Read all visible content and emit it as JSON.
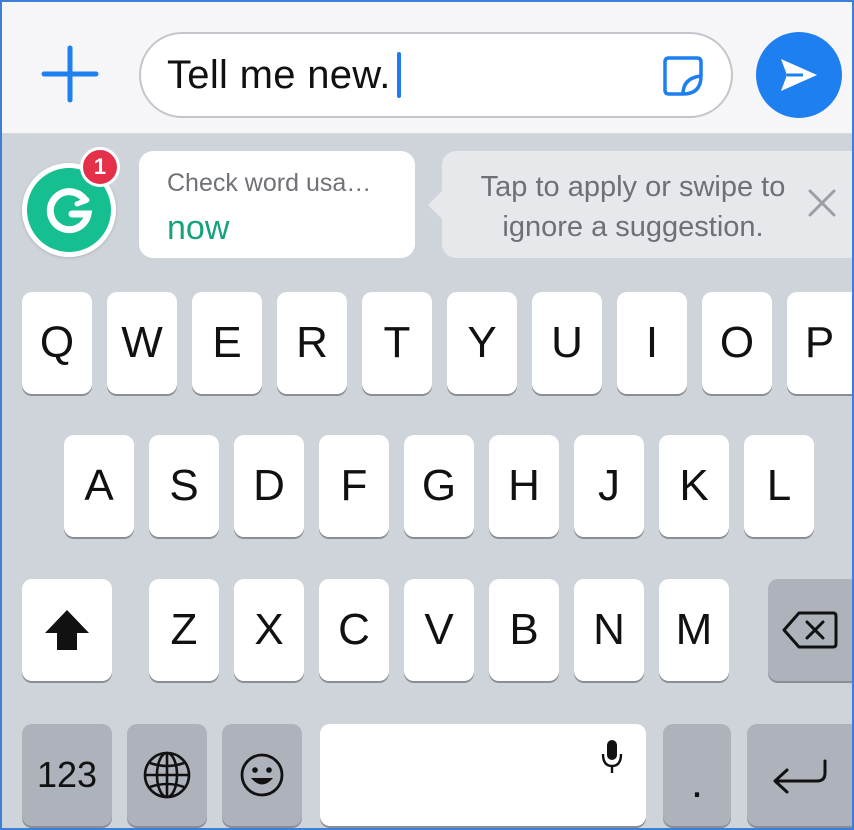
{
  "input_bar": {
    "text_value": "Tell me new.",
    "plus_icon": "plus-icon",
    "sticker_icon": "sticker-icon",
    "send_icon": "send-arrow-icon"
  },
  "grammarly": {
    "badge_count": "1",
    "suggestion_title": "Check word usa…",
    "suggestion_word": "now",
    "tip_text": "Tap to apply or swipe to ignore a suggestion.",
    "close_icon": "close-icon"
  },
  "keyboard": {
    "row1": [
      "Q",
      "W",
      "E",
      "R",
      "T",
      "Y",
      "U",
      "I",
      "O",
      "P"
    ],
    "row2": [
      "A",
      "S",
      "D",
      "F",
      "G",
      "H",
      "J",
      "K",
      "L"
    ],
    "row3": [
      "Z",
      "X",
      "C",
      "V",
      "B",
      "N",
      "M"
    ],
    "shift_icon": "shift-icon",
    "backspace_icon": "backspace-icon",
    "numbers_label": "123",
    "globe_icon": "globe-icon",
    "emoji_icon": "emoji-icon",
    "mic_icon": "microphone-icon",
    "period_label": ".",
    "return_icon": "return-icon"
  },
  "colors": {
    "accent": "#1d7ff0",
    "grammarly_green": "#15bf90",
    "badge_red": "#e5304a"
  }
}
